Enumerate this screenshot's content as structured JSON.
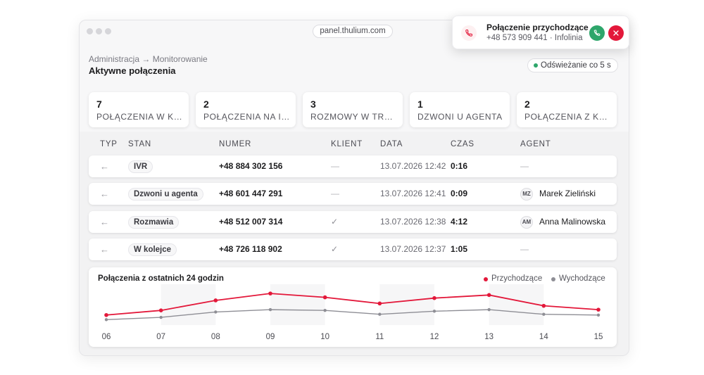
{
  "browser": {
    "url": "panel.thulium.com"
  },
  "page": {
    "breadcrumb": "Administracja → Monitorowanie",
    "title": "Aktywne połączenia",
    "refresh_label": "Odświeżanie co 5 s"
  },
  "stats": [
    {
      "value": "7",
      "label": "POŁĄCZENIA W KOLEJCE"
    },
    {
      "value": "2",
      "label": "POŁĄCZENIA NA IVR"
    },
    {
      "value": "3",
      "label": "ROZMOWY W TRAKCIE"
    },
    {
      "value": "1",
      "label": "DZWONI U AGENTA"
    },
    {
      "value": "2",
      "label": "POŁĄCZENIA Z KAMPANII"
    }
  ],
  "table": {
    "headers": [
      "TYP",
      "STAN",
      "NUMER",
      "KLIENT",
      "DATA",
      "CZAS",
      "AGENT"
    ],
    "rows": [
      {
        "type_icon": "←",
        "state": "IVR",
        "number": "+48 884 302 156",
        "client": "—",
        "date": "13.07.2026 12:42",
        "duration": "0:16",
        "agent_initials": "",
        "agent": "—"
      },
      {
        "type_icon": "←",
        "state": "Dzwoni u agenta",
        "number": "+48 601 447 291",
        "client": "—",
        "date": "13.07.2026 12:41",
        "duration": "0:09",
        "agent_initials": "MZ",
        "agent": "Marek Zieliński"
      },
      {
        "type_icon": "←",
        "state": "Rozmawia",
        "number": "+48 512 007 314",
        "client": "✓",
        "date": "13.07.2026 12:38",
        "duration": "4:12",
        "agent_initials": "AM",
        "agent": "Anna Malinowska"
      },
      {
        "type_icon": "←",
        "state": "W kolejce",
        "number": "+48 726 118 902",
        "client": "✓",
        "date": "13.07.2026 12:37",
        "duration": "1:05",
        "agent_initials": "",
        "agent": "—"
      }
    ]
  },
  "chart_data": {
    "type": "line",
    "title": "Połączenia z ostatnich 24 godzin",
    "categories": [
      "06",
      "07",
      "08",
      "09",
      "10",
      "11",
      "12",
      "13",
      "14",
      "15"
    ],
    "series": [
      {
        "name": "Przychodzące",
        "color": "#e3183a",
        "values": [
          5,
          11,
          24,
          33,
          28,
          20,
          27,
          31,
          17,
          12
        ]
      },
      {
        "name": "Wychodzące",
        "color": "#8e8e95",
        "values": [
          -1,
          2,
          9,
          12,
          11,
          6,
          10,
          12,
          6,
          5
        ]
      }
    ],
    "ylim": [
      -8,
      45
    ],
    "legend_position": "top-right",
    "grid": false
  },
  "incoming_call": {
    "title": "Połączenie przychodzące",
    "subtitle": "+48 573 909 441 · Infolinia"
  },
  "colors": {
    "accent": "#e3183a",
    "success": "#2ea66b",
    "muted": "#8e8e95"
  }
}
